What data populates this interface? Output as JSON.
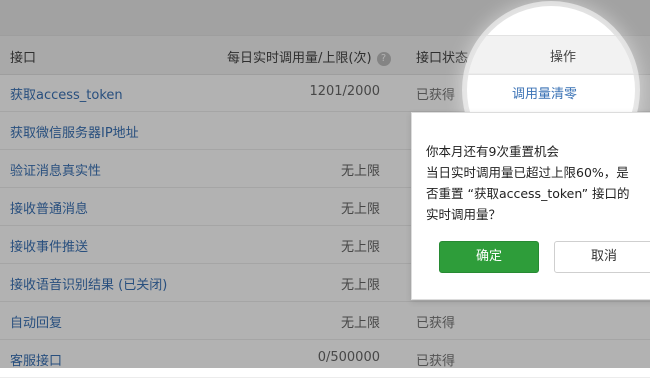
{
  "table": {
    "headers": {
      "interface": "接口",
      "quota": "每日实时调用量/上限(次)",
      "quota_help": "?",
      "status": "接口状态",
      "action": "操作"
    },
    "rows": [
      {
        "name": "获取access_token",
        "quota": "1201/2000",
        "status": "已获得"
      },
      {
        "name": "获取微信服务器IP地址",
        "quota": "",
        "status": ""
      },
      {
        "name": "验证消息真实性",
        "quota": "无上限",
        "status": ""
      },
      {
        "name": "接收普通消息",
        "quota": "无上限",
        "status": ""
      },
      {
        "name": "接收事件推送",
        "quota": "无上限",
        "status": ""
      },
      {
        "name": "接收语音识别结果 (已关闭)",
        "quota": "无上限",
        "status": ""
      },
      {
        "name": "自动回复",
        "quota": "无上限",
        "status": "已获得"
      },
      {
        "name": "客服接口",
        "quota": "0/500000",
        "status": "已获得"
      }
    ],
    "row0_action": "调用量清零"
  },
  "popover": {
    "lines": [
      "你本月还有9次重置机会",
      "当日实时调用量已超过上限60%，是",
      "否重置 “获取access_token” 接口的",
      "实时调用量？"
    ],
    "confirm": "确定",
    "cancel": "取消"
  },
  "colors": {
    "link": "#3a72b5",
    "confirm": "#2e9d3a"
  }
}
